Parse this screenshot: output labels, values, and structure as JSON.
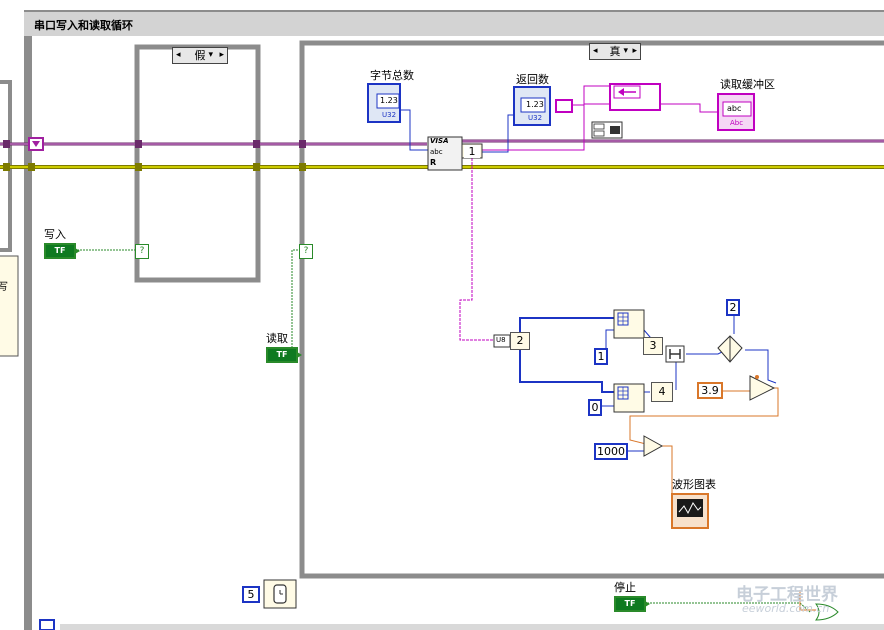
{
  "loop": {
    "title": "串口写入和读取循环"
  },
  "case_false": {
    "selector": "假"
  },
  "case_true": {
    "selector": "真"
  },
  "controls": {
    "write": "写入",
    "read": "读取",
    "stop": "停止",
    "bool_glyph": "TF"
  },
  "nodes": {
    "byte_count": {
      "label": "字节总数",
      "value": "1.23",
      "type": "U32"
    },
    "return_count": {
      "label": "返回数",
      "value": "1.23",
      "type": "U32"
    },
    "read_buffer": {
      "label": "读取缓冲区",
      "value": "abc",
      "sub": "Abc"
    },
    "waveform": {
      "label": "波形图表"
    },
    "visa_read": {
      "line1": "VISA",
      "line2": "abc",
      "line3": "R",
      "badge": "1"
    },
    "index1": {
      "badge": "2"
    },
    "idx_a": {
      "badge": "3"
    },
    "idx_b": {
      "badge": "4"
    },
    "array_const_u8": "U8"
  },
  "constants": {
    "c_one": "1",
    "c_zero": "0",
    "c_two": "2",
    "c_39": "3.9",
    "c_1000": "1000",
    "c_5": "5"
  },
  "indicator_marks": {
    "q": "?"
  },
  "left_fragment": {
    "text": "写"
  },
  "watermark": {
    "cn": "电子工程世界",
    "en": "eeworld.com.cn"
  },
  "colors": {
    "wire_pink": "#c000c0",
    "wire_yellow": "#c8c800",
    "wire_blue": "#1c34c4",
    "wire_orange": "#d9772a",
    "wire_green": "#2a8a2a",
    "frame_gray": "#8c8c8c"
  }
}
